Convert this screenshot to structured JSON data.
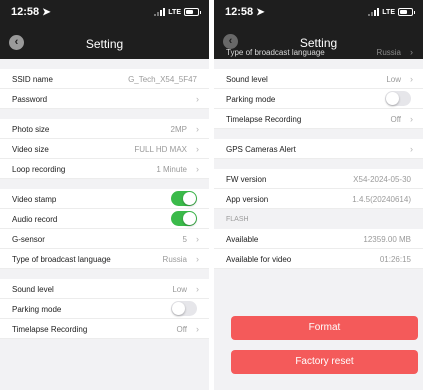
{
  "colors": {
    "header_bg": "#1e1e1e",
    "toggle_on": "#3bba4a",
    "toggle_off": "#e6e6ea",
    "danger": "#f45a5a"
  },
  "status": {
    "time": "12:58",
    "network": "LTE"
  },
  "left": {
    "title": "Setting",
    "groups": [
      [
        {
          "label": "SSID name",
          "value": "G_Tech_X54_5F47",
          "chevron": false
        },
        {
          "label": "Password",
          "value": "",
          "chevron": true
        }
      ],
      [
        {
          "label": "Photo size",
          "value": "2MP",
          "chevron": true
        },
        {
          "label": "Video size",
          "value": "FULL HD MAX",
          "chevron": true
        },
        {
          "label": "Loop recording",
          "value": "1 Minute",
          "chevron": true
        }
      ],
      [
        {
          "label": "Video stamp",
          "toggle": true
        },
        {
          "label": "Audio record",
          "toggle": true
        },
        {
          "label": "G-sensor",
          "value": "5",
          "chevron": true
        },
        {
          "label": "Type of broadcast language",
          "value": "Russia",
          "chevron": true
        }
      ],
      [
        {
          "label": "Sound level",
          "value": "Low",
          "chevron": true
        },
        {
          "label": "Parking mode",
          "toggle": false
        },
        {
          "label": "Timelapse Recording",
          "value": "Off",
          "chevron": true
        }
      ]
    ]
  },
  "right": {
    "title": "Setting",
    "clipped_row": {
      "label": "Type of broadcast language",
      "value": "Russia"
    },
    "group1": [
      {
        "label": "Sound level",
        "value": "Low",
        "chevron": true
      },
      {
        "label": "Parking mode",
        "toggle": false
      },
      {
        "label": "Timelapse Recording",
        "value": "Off",
        "chevron": true
      }
    ],
    "alert": {
      "label": "GPS Cameras Alert"
    },
    "info": [
      {
        "label": "FW version",
        "value": "X54-2024-05-30"
      },
      {
        "label": "App version",
        "value": "1.4.5(20240614)"
      }
    ],
    "flash_label": "FLASH",
    "flash": [
      {
        "label": "Available",
        "value": "12359.00 MB"
      },
      {
        "label": "Available for video",
        "value": "01:26:15"
      }
    ],
    "format_label": "Format",
    "reset_label": "Factory reset"
  }
}
